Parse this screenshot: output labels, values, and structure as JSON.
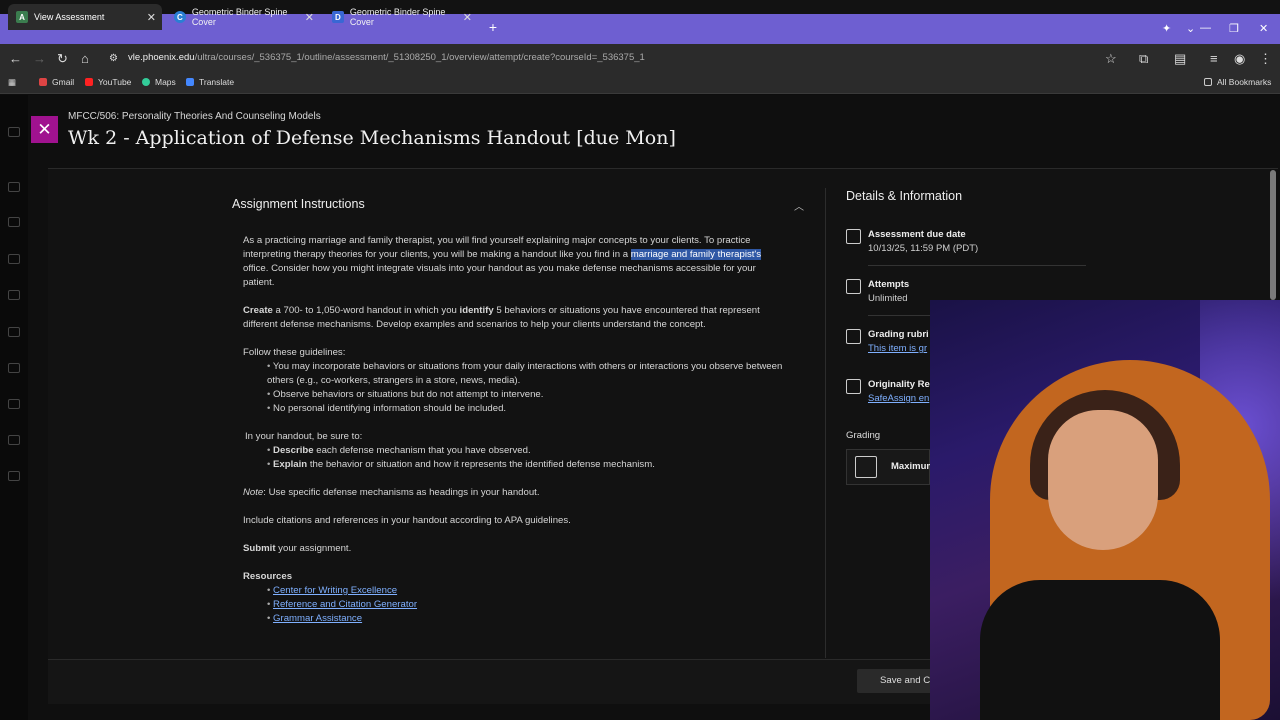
{
  "browser": {
    "tabs": [
      {
        "label": "View Assessment",
        "active": true,
        "favicon": "A"
      },
      {
        "label": "Geometric Binder Spine Cover",
        "active": false,
        "favicon": "C"
      },
      {
        "label": "Geometric Binder Spine Cover",
        "active": false,
        "favicon": "D"
      }
    ],
    "url_domain": "vle.phoenix.edu",
    "url_path": "/ultra/courses/_536375_1/outline/assessment/_51308250_1/overview/attempt/create?courseId=_536375_1",
    "bookmarks": [
      "Gmail",
      "YouTube",
      "Maps",
      "Translate"
    ],
    "all_bookmarks": "All Bookmarks"
  },
  "page": {
    "course": "MFCC/506: Personality Theories And Counseling Models",
    "title": "Wk 2 - Application of Defense Mechanisms Handout [due Mon]"
  },
  "instructions": {
    "heading": "Assignment Instructions",
    "p1_a": "As a practicing marriage and family therapist, you will find yourself explaining major concepts to your clients. To practice interpreting therapy theories for your clients, you will be making a handout like you find in a ",
    "p1_hl": "marriage and family therapist's",
    "p1_b": " office. Consider how you might integrate visuals into your handout as you make defense mechanisms accessible for your patient.",
    "p2_create": "Create",
    "p2_a": " a 700- to 1,050-word handout in which you ",
    "p2_identify": "identify",
    "p2_b": " 5 behaviors or situations you have encountered that represent different defense mechanisms. Develop examples and scenarios to help your clients understand the concept.",
    "guidelines_intro": "Follow these guidelines:",
    "guidelines": [
      "You may incorporate behaviors or situations from your daily interactions with others or interactions you observe between others (e.g., co-workers, strangers in a store, news, media).",
      "Observe behaviors or situations but do not attempt to intervene.",
      "No personal identifying information should be included."
    ],
    "sure_intro": "In your handout, be sure to:",
    "sure_1_b": "Describe",
    "sure_1": " each defense mechanism that you have observed.",
    "sure_2_b": "Explain",
    "sure_2": " the behavior or situation and how it represents the identified defense mechanism.",
    "note_label": "Note",
    "note": ": Use specific defense mechanisms as headings in your handout.",
    "citations": "Include citations and references in your handout according to APA guidelines.",
    "submit_b": "Submit",
    "submit": " your assignment.",
    "resources_heading": "Resources",
    "resources": [
      "Center for Writing Excellence",
      "Reference and Citation Generator",
      "Grammar Assistance"
    ]
  },
  "details": {
    "heading": "Details & Information",
    "due_label": "Assessment due date",
    "due_value": "10/13/25, 11:59 PM (PDT)",
    "attempts_label": "Attempts",
    "attempts_value": "Unlimited",
    "rubric_label": "Grading rubri",
    "rubric_value": "This item is gr",
    "originality_label": "Originality Re",
    "originality_value": "SafeAssign en",
    "grading_heading": "Grading",
    "grading_box": "Maximum"
  },
  "footer": {
    "save_label": "Save and C"
  },
  "colors": {
    "tabbar": "#6e5fd1",
    "close": "#a0128f",
    "link": "#7fb0ff",
    "highlight": "#2f58a5"
  }
}
